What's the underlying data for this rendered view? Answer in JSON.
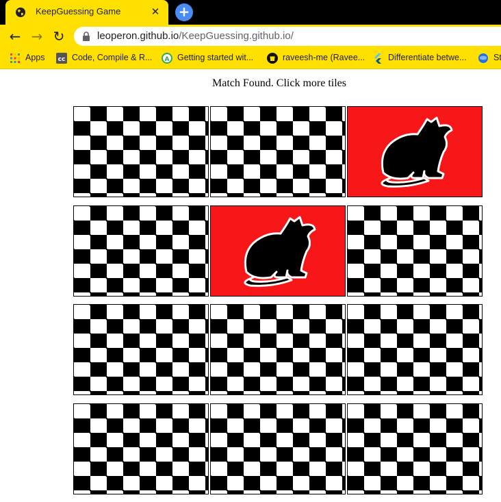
{
  "browser": {
    "tab_title": "KeepGuessing Game",
    "tab_close": "✕",
    "new_tab": "+",
    "url_host": "leoperon.github.io",
    "url_path": "/KeepGuessing.github.io/",
    "bookmarks": [
      {
        "label": "Apps",
        "icon": "apps-grid-icon"
      },
      {
        "label": "Code, Compile & R...",
        "icon": "cc-icon"
      },
      {
        "label": "Getting started wit...",
        "icon": "green-a-icon"
      },
      {
        "label": "raveesh-me (Ravee...",
        "icon": "github-icon"
      },
      {
        "label": "Differentiate betwe...",
        "icon": "flutter-icon"
      },
      {
        "label": "St",
        "icon": "globe-icon"
      }
    ],
    "colors": {
      "chrome": "#FFE000",
      "tabstrip": "#000000",
      "new_tab": "#4A8CF6"
    }
  },
  "game": {
    "status": "Match Found. Click more tiles",
    "revealed_color": "#F71618",
    "tiles": [
      {
        "state": "hidden"
      },
      {
        "state": "hidden"
      },
      {
        "state": "revealed",
        "image": "cat-icon"
      },
      {
        "state": "hidden"
      },
      {
        "state": "revealed",
        "image": "cat-icon"
      },
      {
        "state": "hidden"
      },
      {
        "state": "hidden"
      },
      {
        "state": "hidden"
      },
      {
        "state": "hidden"
      },
      {
        "state": "hidden"
      },
      {
        "state": "hidden"
      },
      {
        "state": "hidden"
      }
    ]
  }
}
